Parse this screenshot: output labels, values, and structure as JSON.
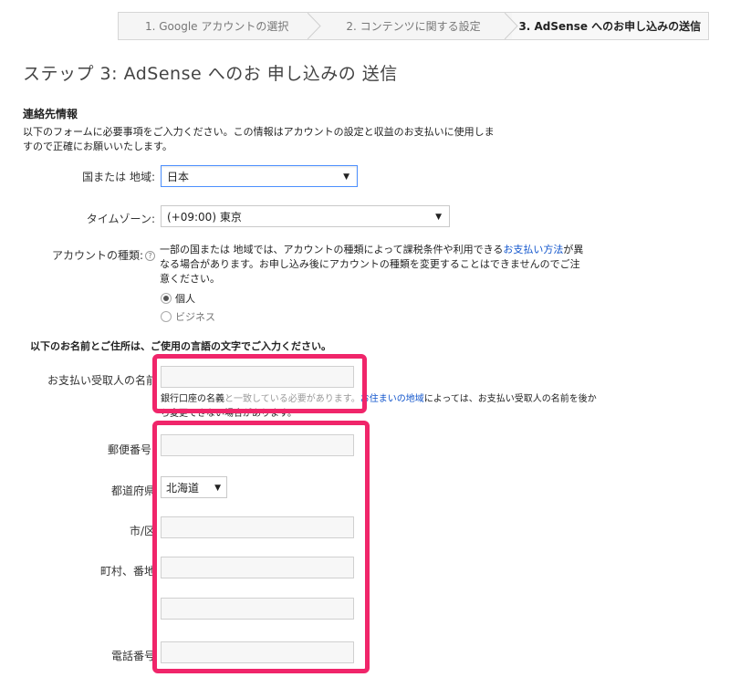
{
  "stepper": {
    "steps": [
      {
        "label": "1. Google アカウントの選択"
      },
      {
        "label": "2. コンテンツに関する設定"
      },
      {
        "label": "3. AdSense へのお申し込みの送信"
      }
    ]
  },
  "page_title": "ステップ 3: AdSense へのお 申し込みの 送信",
  "contact": {
    "heading": "連絡先情報",
    "intro": "以下のフォームに必要事項をご入力ください。この情報はアカウントの設定と収益のお支払いに使用しますので正確にお願いいたします。"
  },
  "country": {
    "label": "国または 地域:",
    "value": "日本"
  },
  "timezone": {
    "label": "タイムゾーン:",
    "value": "(+09:00) 東京"
  },
  "account_type": {
    "label": "アカウントの種類:",
    "help_icon": "?",
    "desc_before": "一部の国または 地域では、アカウントの種類によって課税条件や利用できる",
    "desc_link": "お支払い方法",
    "desc_after": "が異なる場合があります。お申し込み後にアカウントの種類を変更することはできませんのでご注意ください。",
    "options": [
      {
        "label": "個人",
        "checked": true
      },
      {
        "label": "ビジネス",
        "checked": false
      }
    ]
  },
  "name_section": {
    "heading": "以下のお名前とご住所は、ご使用の言語の文字でご入力ください。"
  },
  "payee": {
    "label": "お支払い受取人の名前",
    "value": "",
    "note_before": "銀行口座の名義",
    "note_hidden": "と一致している必要があります。",
    "note_link": "お住まいの地域",
    "note_after": "によっては、お支払い受取人の名前を後から変更できない場合があります。"
  },
  "address": {
    "postal_label": "郵便番号:",
    "prefecture_label": "都道府県",
    "prefecture_value": "北海道",
    "city_label": "市/区",
    "street_label": "町村、番地",
    "phone_label": "電話番号"
  },
  "colors": {
    "highlight": "#f0256a",
    "link": "#1155cc",
    "focus": "#4d90fe"
  }
}
